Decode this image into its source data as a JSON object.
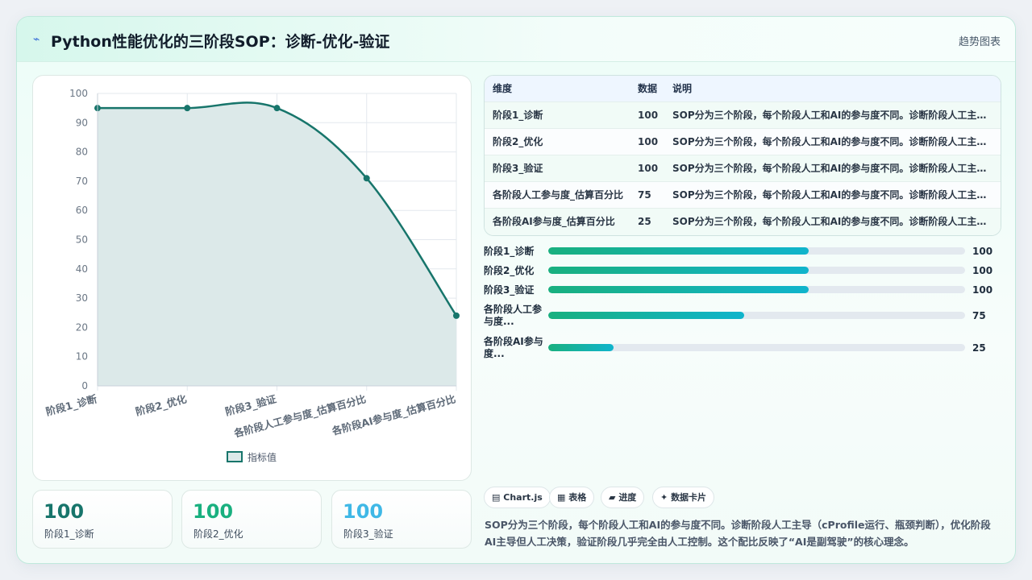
{
  "header": {
    "icon": "chart-line-icon",
    "title": "Python性能优化的三阶段SOP：诊断-优化-验证",
    "link": "趋势图表"
  },
  "chart_data": {
    "type": "line",
    "categories": [
      "阶段1_诊断",
      "阶段2_优化",
      "阶段3_验证",
      "各阶段人工参与度_估算百分比",
      "各阶段AI参与度_估算百分比"
    ],
    "series": [
      {
        "name": "指标值",
        "values": [
          95,
          95,
          95,
          71,
          24
        ]
      }
    ],
    "ylim": [
      0,
      100
    ],
    "yticks": [
      0,
      10,
      20,
      30,
      40,
      50,
      60,
      70,
      80,
      90,
      100
    ],
    "grid": true,
    "legend": "bottom",
    "line_color": "#17756b",
    "fill_color": "#dce9e9"
  },
  "stats": [
    {
      "value": "100",
      "label": "阶段1_诊断",
      "color": "#17756b"
    },
    {
      "value": "100",
      "label": "阶段2_优化",
      "color": "#19b07f"
    },
    {
      "value": "100",
      "label": "阶段3_验证",
      "color": "#3fb8e6"
    }
  ],
  "table": {
    "headers": [
      "维度",
      "数据",
      "说明"
    ],
    "rows": [
      [
        "阶段1_诊断",
        "100",
        "SOP分为三个阶段，每个阶段人工和AI的参与度不同。诊断阶段人工主导（cProfile运行、瓶颈判断），优化阶段AI主导但人工决策"
      ],
      [
        "阶段2_优化",
        "100",
        "SOP分为三个阶段，每个阶段人工和AI的参与度不同。诊断阶段人工主导（cProfile运行、瓶颈判断），优化阶段AI主导但人工决策"
      ],
      [
        "阶段3_验证",
        "100",
        "SOP分为三个阶段，每个阶段人工和AI的参与度不同。诊断阶段人工主导（cProfile运行、瓶颈判断），优化阶段AI主导但人工决策"
      ],
      [
        "各阶段人工参与度_估算百分比",
        "75",
        "SOP分为三个阶段，每个阶段人工和AI的参与度不同。诊断阶段人工主导（cProfile运行、瓶颈判断），优化阶段AI主导但人工决策"
      ],
      [
        "各阶段AI参与度_估算百分比",
        "25",
        "SOP分为三个阶段，每个阶段人工和AI的参与度不同。诊断阶段人工主导（cProfile运行、瓶颈判断），优化阶段AI主导但人工决策"
      ]
    ]
  },
  "bars": [
    {
      "label": "阶段1_诊断",
      "value": "100",
      "progress": 0.625
    },
    {
      "label": "阶段2_优化",
      "value": "100",
      "progress": 0.625
    },
    {
      "label": "阶段3_验证",
      "value": "100",
      "progress": 0.625
    },
    {
      "label": "各阶段人工参与度...",
      "value": "75",
      "progress": 0.47
    },
    {
      "label": "各阶段AI参与度...",
      "value": "25",
      "progress": 0.157
    }
  ],
  "tags": [
    {
      "icon": "▤",
      "label": "Chart.js"
    },
    {
      "icon": "▦",
      "label": "表格"
    },
    {
      "icon": "▰",
      "label": "进度"
    },
    {
      "icon": "✦",
      "label": "数据卡片"
    }
  ],
  "summary": "SOP分为三个阶段，每个阶段人工和AI的参与度不同。诊断阶段人工主导（cProfile运行、瓶颈判断），优化阶段AI主导但人工决策，验证阶段几乎完全由人工控制。这个配比反映了“AI是副驾驶”的核心理念。"
}
